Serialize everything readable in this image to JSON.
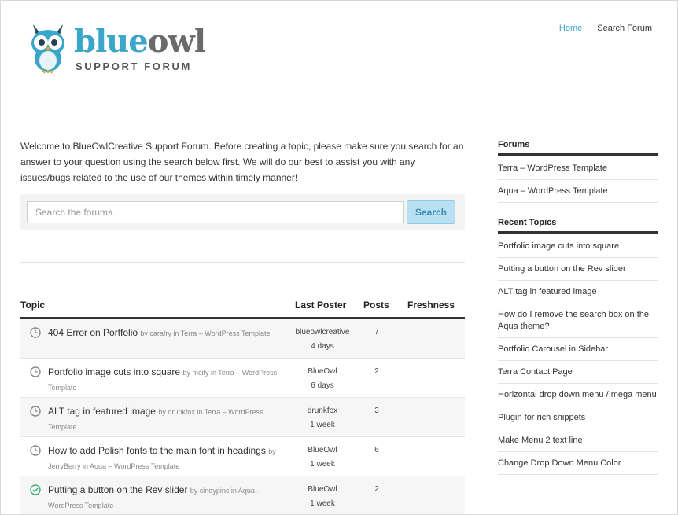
{
  "header": {
    "brand_part1": "blue",
    "brand_part2": "owl",
    "brand_sub": "SUPPORT FORUM",
    "nav": [
      {
        "label": "Home"
      },
      {
        "label": "Search Forum"
      }
    ]
  },
  "welcome": "Welcome to BlueOwlCreative Support Forum. Before creating a topic, please make sure you search for an answer to your question using the search below first. We will do our best to assist you with any issues/bugs related to the use of our themes within timely manner!",
  "search": {
    "placeholder": "Search the forums..",
    "button_label": "Search"
  },
  "table": {
    "headers": {
      "topic": "Topic",
      "last_poster": "Last Poster",
      "posts": "Posts",
      "freshness": "Freshness"
    },
    "rows": [
      {
        "title": "404 Error on Portfolio",
        "meta": "by carafry  in Terra – WordPress Template",
        "poster": "blueowlcreative",
        "age": "4 days",
        "posts": "7",
        "status": "clock"
      },
      {
        "title": "Portfolio image cuts into square",
        "meta": "by mcity  in Terra – WordPress Template",
        "poster": "BlueOwl",
        "age": "6 days",
        "posts": "2",
        "status": "clock"
      },
      {
        "title": "ALT tag in featured image",
        "meta": "by drunkfox  in Terra – WordPress Template",
        "poster": "drunkfox",
        "age": "1 week",
        "posts": "3",
        "status": "clock"
      },
      {
        "title": "How to add Polish fonts to the main font in headings",
        "meta": "by JerryBerry  in Aqua – WordPress Template",
        "poster": "BlueOwl",
        "age": "1 week",
        "posts": "6",
        "status": "clock"
      },
      {
        "title": "Putting a button on the Rev slider",
        "meta": "by cindypinc  in Aqua – WordPress Template",
        "poster": "BlueOwl",
        "age": "1 week",
        "posts": "2",
        "status": "check"
      }
    ]
  },
  "sidebar": {
    "forums_heading": "Forums",
    "forums": [
      "Terra – WordPress Template",
      "Aqua – WordPress Template"
    ],
    "recent_heading": "Recent Topics",
    "recent": [
      "Portfolio image cuts into square",
      "Putting a button on the Rev slider",
      "ALT tag in featured image",
      "How do I remove the search box on the Aqua theme?",
      "Portfolio Carousel in Sidebar",
      "Terra Contact Page",
      "Horizontal drop down menu / mega menu",
      "Plugin for rich snippets",
      "Make Menu 2 text line",
      "Change Drop Down Menu Color"
    ]
  },
  "colors": {
    "accent": "#3ba6c9",
    "check_green": "#3ab071",
    "clock_gray": "#8a8a8a"
  }
}
